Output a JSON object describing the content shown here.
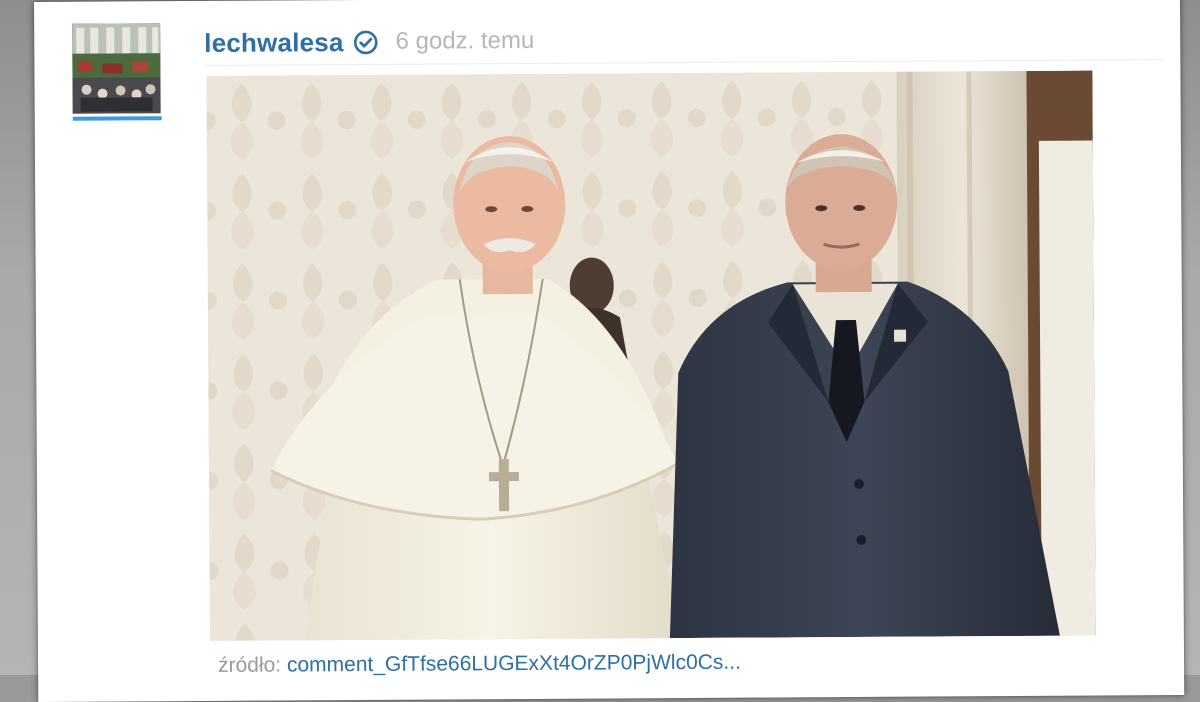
{
  "post": {
    "username": "lechwalesa",
    "time_ago": "6 godz. temu",
    "caption_prefix": "źródło:",
    "caption_link": "comment_GfTfse66LUGExXt4OrZP0PjWlc0Cs..."
  },
  "icons": {
    "verified": "verified-check-icon"
  },
  "colors": {
    "username": "#2d6fa8",
    "accent_underline": "#3b9be0",
    "muted_text": "#b6b6b6"
  }
}
